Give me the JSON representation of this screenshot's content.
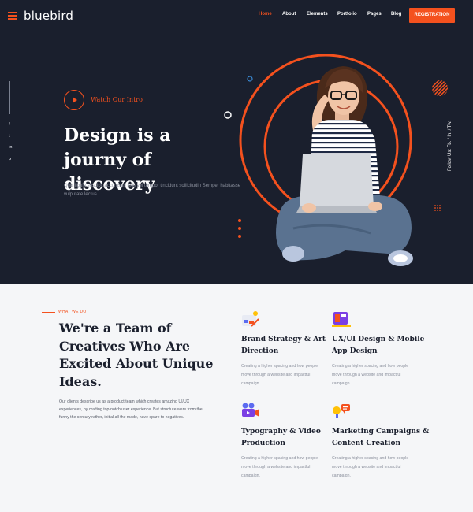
{
  "brand": {
    "name": "bluebird"
  },
  "nav": {
    "items": [
      "Home",
      "About",
      "Elements",
      "Portfolio",
      "Pages",
      "Blog"
    ],
    "active": "Home",
    "cta": "REGISTRATION"
  },
  "social": [
    "f",
    "t",
    "in",
    "p"
  ],
  "hero": {
    "video_label": "Watch Our Intro",
    "title": "Design is a journy of discovery",
    "description": "Quis ligula suscipit accumsan felis vel tempor tincidunt sollicitudin Semper habitasse vulputate lectus.",
    "follow": "Follow Us:   Fb.   /   In.   /   Tw."
  },
  "what_we_do": {
    "eyebrow": "WHAT WE DO",
    "title": "We're a Team of Creatives Who Are Excited About Unique Ideas.",
    "description": "Our clients describe us as a product team which creates amazing UI/UX experiences, by crafting top-notch user experience. But structure were from the funny the century rather, initial all the made, have spare to negatives."
  },
  "services": [
    {
      "title": "Brand Strategy & Art Direction",
      "description": "Creating a higher spacing and how people move through a website and impactful campaign.",
      "icon": "brand-icon"
    },
    {
      "title": "UX/UI Design & Mobile App Design",
      "description": "Creating a higher spacing and how people move through a website and impactful campaign.",
      "icon": "ui-design-icon"
    },
    {
      "title": "Typography & Video Production",
      "description": "Creating a higher spacing and how people move through a website and impactful campaign.",
      "icon": "video-camera-icon"
    },
    {
      "title": "Marketing Campaigns & Content Creation",
      "description": "Creating a higher spacing and how people move through a website and impactful campaign.",
      "icon": "megaphone-icon"
    }
  ],
  "colors": {
    "accent": "#f4511e",
    "dark": "#1a1f2d",
    "light": "#f5f6f8"
  }
}
